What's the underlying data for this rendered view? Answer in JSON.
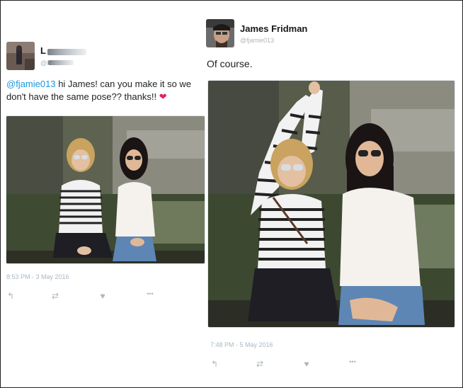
{
  "left_tweet": {
    "name": "L",
    "handle": "@l",
    "mention": "@fjamie013",
    "text": " hi James! can you make it so we don't have the same pose?? thanks!!",
    "emoji": "❤",
    "timestamp": "8:53 PM - 3 May 2016",
    "actions": {
      "reply": "↰",
      "retweet": "⇄",
      "like": "♥",
      "more": "•••"
    }
  },
  "right_tweet": {
    "name": "James Fridman",
    "handle": "@fjamie013",
    "text": "Of course.",
    "timestamp": "7:48 PM - 5 May 2016",
    "actions": {
      "reply": "↰",
      "retweet": "⇄",
      "like": "♥",
      "more": "•••"
    }
  },
  "colors": {
    "link": "#1b95e0",
    "meta": "#aab8c2",
    "heart": "#e0245e"
  }
}
